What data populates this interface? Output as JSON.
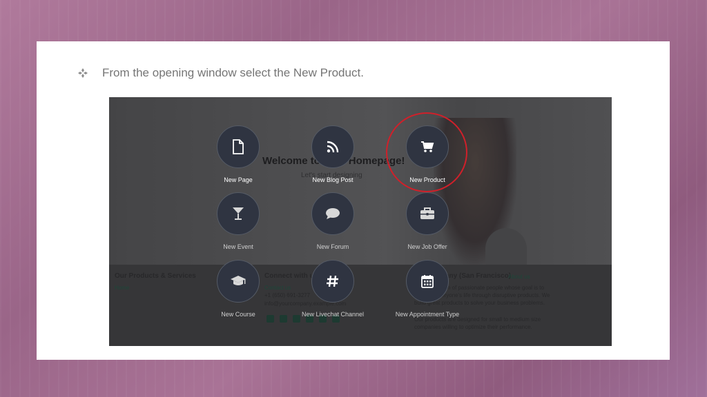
{
  "slide": {
    "instruction": "From the opening window select the New Product."
  },
  "screenshot": {
    "background": {
      "welcome": "Welcome to your Homepage!",
      "subtitle": "Let's start designing",
      "footer": {
        "col1_title": "Our Products & Services",
        "col1_link": "Home",
        "col2_title": "Connect with us",
        "col2_contact": "Contact us",
        "col2_phone": "+1 (650) 691-3277",
        "col2_email": "info@yourcompany.example.com",
        "col3_title": "My Company (San Francisco)",
        "col3_link": "About us",
        "col3_text1": "We are a team of passionate people whose goal is to improve everyone's life through disruptive products. We build great products to solve your business problems.",
        "col3_text2": "Our products are designed for small to medium size companies willing to optimize their performance."
      }
    },
    "tiles": [
      {
        "label": "New Page",
        "icon": "file-icon"
      },
      {
        "label": "New Blog Post",
        "icon": "rss-icon"
      },
      {
        "label": "New Product",
        "icon": "cart-icon"
      },
      {
        "label": "New Event",
        "icon": "glass-icon"
      },
      {
        "label": "New Forum",
        "icon": "comment-icon"
      },
      {
        "label": "New Job Offer",
        "icon": "briefcase-icon"
      },
      {
        "label": "New Course",
        "icon": "graduation-cap-icon"
      },
      {
        "label": "New Livechat Channel",
        "icon": "hashtag-icon"
      },
      {
        "label": "New Appointment Type",
        "icon": "calendar-icon"
      }
    ],
    "highlight_color": "#d0202a"
  }
}
